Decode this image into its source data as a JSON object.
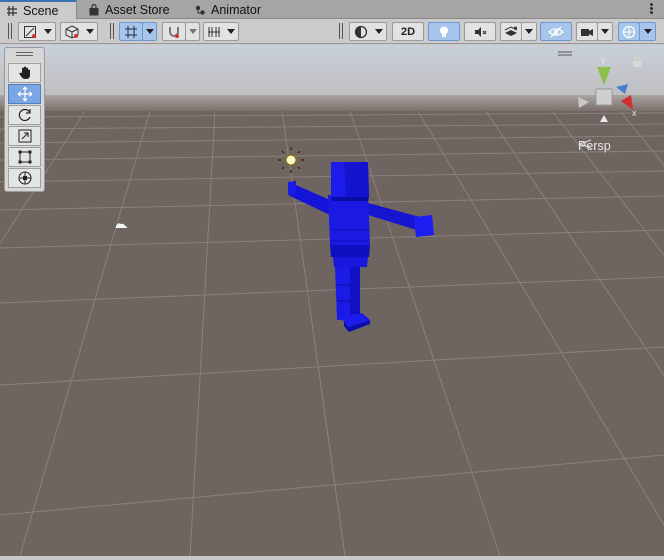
{
  "tabs": [
    {
      "label": "Scene",
      "icon": "grid-icon",
      "active": true
    },
    {
      "label": "Asset Store",
      "icon": "shopping-bag-icon",
      "active": false
    },
    {
      "label": "Animator",
      "icon": "animator-icon",
      "active": false
    }
  ],
  "toolbar": {
    "mode_2d_label": "2D"
  },
  "scene": {
    "persp_label": "Persp",
    "gizmo_axes": {
      "x": "x",
      "y": "y"
    },
    "sky_color": "#cbd2dc",
    "ground_color": "#6e6460",
    "character_color": "#1f1ff0"
  }
}
